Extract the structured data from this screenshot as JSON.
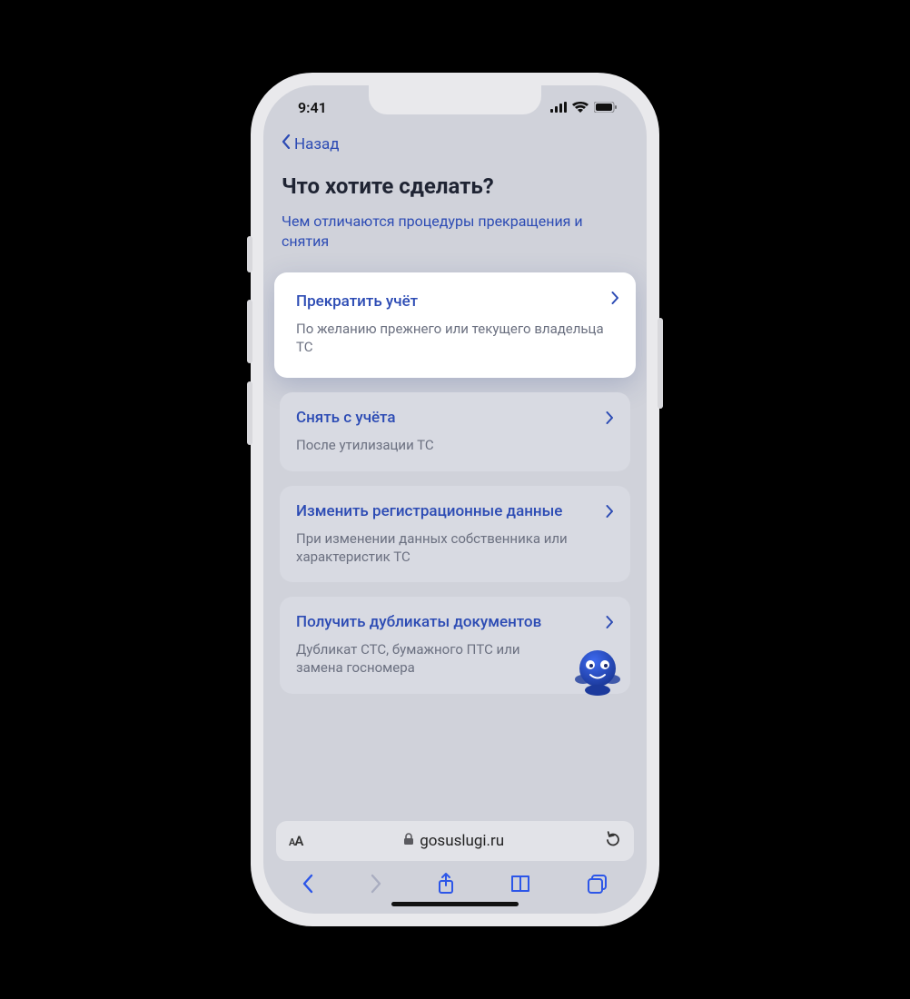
{
  "status": {
    "time": "9:41"
  },
  "nav": {
    "back": "Назад"
  },
  "heading": "Что хотите сделать?",
  "subLink": "Чем отличаются процедуры прекращения и снятия",
  "cards": [
    {
      "title": "Прекратить учёт",
      "desc": "По желанию прежнего или текущего владельца ТС"
    },
    {
      "title": "Снять с учёта",
      "desc": "После утилизации ТС"
    },
    {
      "title": "Изменить регистрационные данные",
      "desc": "При изменении данных собственника или характеристик ТС"
    },
    {
      "title": "Получить дубликаты документов",
      "desc": "Дубликат СТС, бумажного ПТС или замена госномера"
    }
  ],
  "address": {
    "domain": "gosuslugi.ru"
  }
}
